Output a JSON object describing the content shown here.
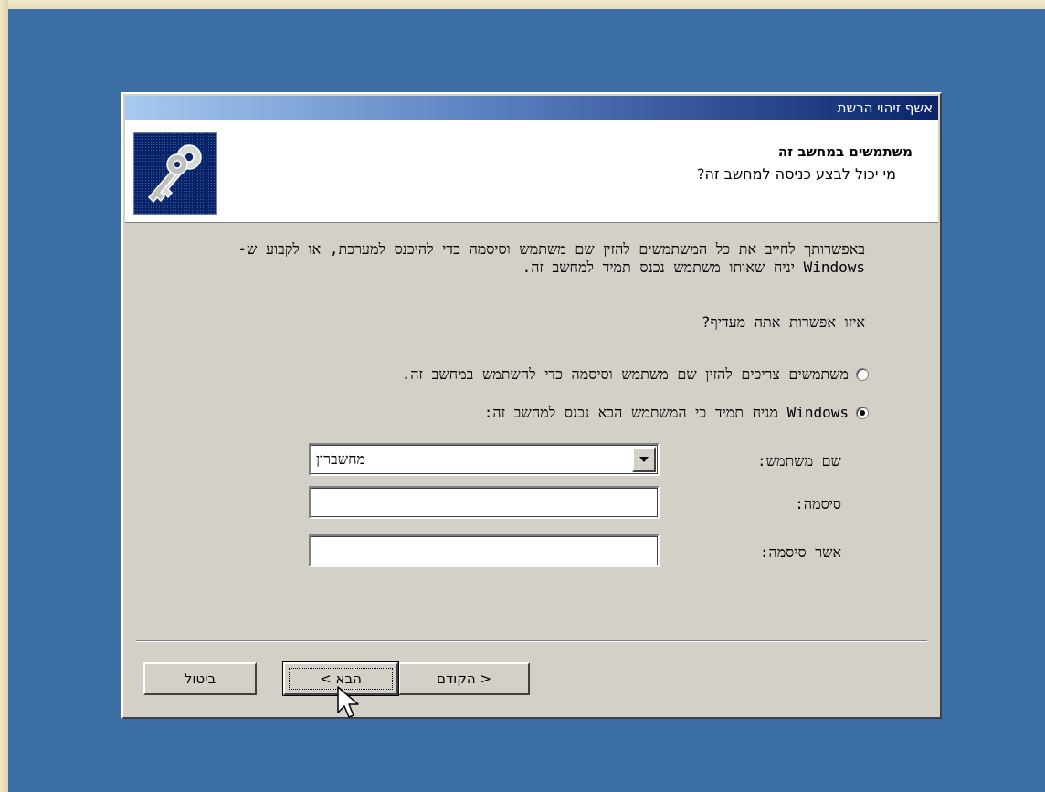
{
  "window": {
    "title": "אשף זיהוי הרשת"
  },
  "header": {
    "title": "משתמשים במחשב זה",
    "subtitle": "מי יכול לבצע כניסה למחשב זה?",
    "icon": "keys-icon"
  },
  "body": {
    "intro": "באפשרותך לחייב את כל המשתמשים להזין שם משתמש וסיסמה כדי להיכנס למערכת, או לקבוע ש- Windows יניח שאותו משתמש נכנס תמיד למחשב זה.",
    "question": "איזו אפשרות אתה מעדיף?",
    "options": [
      {
        "label": "משתמשים צריכים להזין שם משתמש וסיסמה כדי להשתמש במחשב זה.",
        "checked": false
      },
      {
        "label": "Windows מניח תמיד כי המשתמש הבא נכנס למחשב זה:",
        "checked": true
      }
    ]
  },
  "fields": {
    "username_label": "שם משתמש:",
    "username_value": "מחשברון",
    "password_label": "סיסמה:",
    "password_value": "",
    "confirm_label": "אשר סיסמה:",
    "confirm_value": ""
  },
  "buttons": {
    "back": "< הקודם",
    "next": "הבא >",
    "cancel": "ביטול"
  },
  "colors": {
    "desktop": "#3a6ea5",
    "dialog": "#d4d0c8",
    "title_start": "#a6caf0",
    "title_end": "#0a246a"
  }
}
